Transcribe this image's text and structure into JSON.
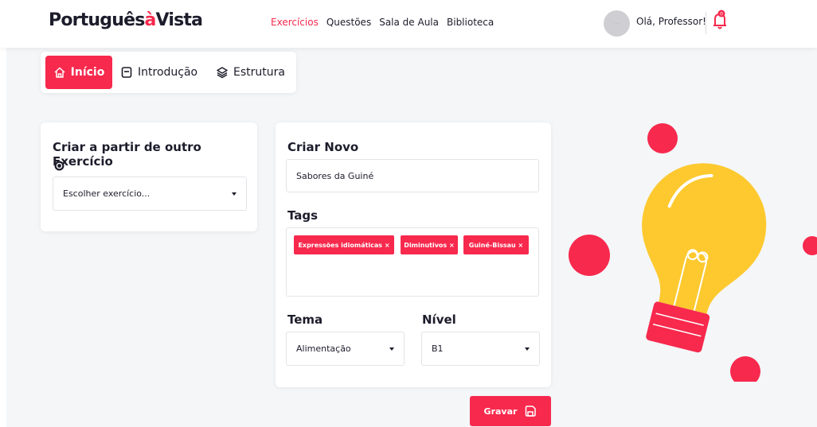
{
  "header": {
    "logo_main": "Português",
    "logo_a": "à",
    "logo_tail": "Vista",
    "nav": [
      "Exercícios",
      "Questões",
      "Sala de Aula",
      "Biblioteca"
    ],
    "greeting": "Olá, Professor!",
    "notification_count": "0"
  },
  "tabs": [
    {
      "label": "Início",
      "icon": "home-icon"
    },
    {
      "label": "Introdução",
      "icon": "document-icon"
    },
    {
      "label": "Estrutura",
      "icon": "layers-icon"
    }
  ],
  "from_existing": {
    "title": "Criar a partir de outro Exercício",
    "info_icon": "target-icon",
    "select_placeholder": "Escolher exercício..."
  },
  "create_new": {
    "title": "Criar Novo",
    "name_value": "Sabores da Guiné",
    "tags_label": "Tags",
    "tags": [
      "Expressões idiomáticas",
      "Diminutivos",
      "Guiné-Bissau"
    ],
    "tema_label": "Tema",
    "tema_value": "Alimentação",
    "nivel_label": "Nível",
    "nivel_value": "B1"
  },
  "save_button": {
    "label": "Gravar",
    "icon": "save-icon"
  },
  "colors": {
    "accent": "#f7294d",
    "bulb": "#fdc92f",
    "background": "#f4f6f8"
  }
}
